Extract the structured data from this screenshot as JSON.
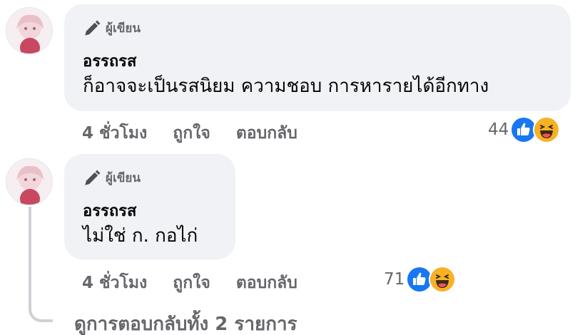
{
  "comments": [
    {
      "author_badge": "ผู้เขียน",
      "author": "อรรถรส",
      "text": "ก็อาจจะเป็นรสนิยม ความชอบ การหารายได้อีกทาง",
      "time": "4 ชั่วโมง",
      "like_label": "ถูกใจ",
      "reply_label": "ตอบกลับ",
      "reaction_count": "44",
      "reactions": [
        "like-icon",
        "haha-icon"
      ]
    },
    {
      "author_badge": "ผู้เขียน",
      "author": "อรรถรส",
      "text": "ไม่ใช่ ก. กอไก่",
      "time": "4 ชั่วโมง",
      "like_label": "ถูกใจ",
      "reply_label": "ตอบกลับ",
      "reaction_count": "71",
      "reactions": [
        "like-icon",
        "haha-icon"
      ]
    }
  ],
  "view_replies": "ดูการตอบกลับทั้ง 2 รายการ",
  "colors": {
    "bubble": "#f0f2f5",
    "meta_text": "#65676b",
    "like_blue": "#1877f2",
    "haha_yellow": "#f7b125"
  }
}
